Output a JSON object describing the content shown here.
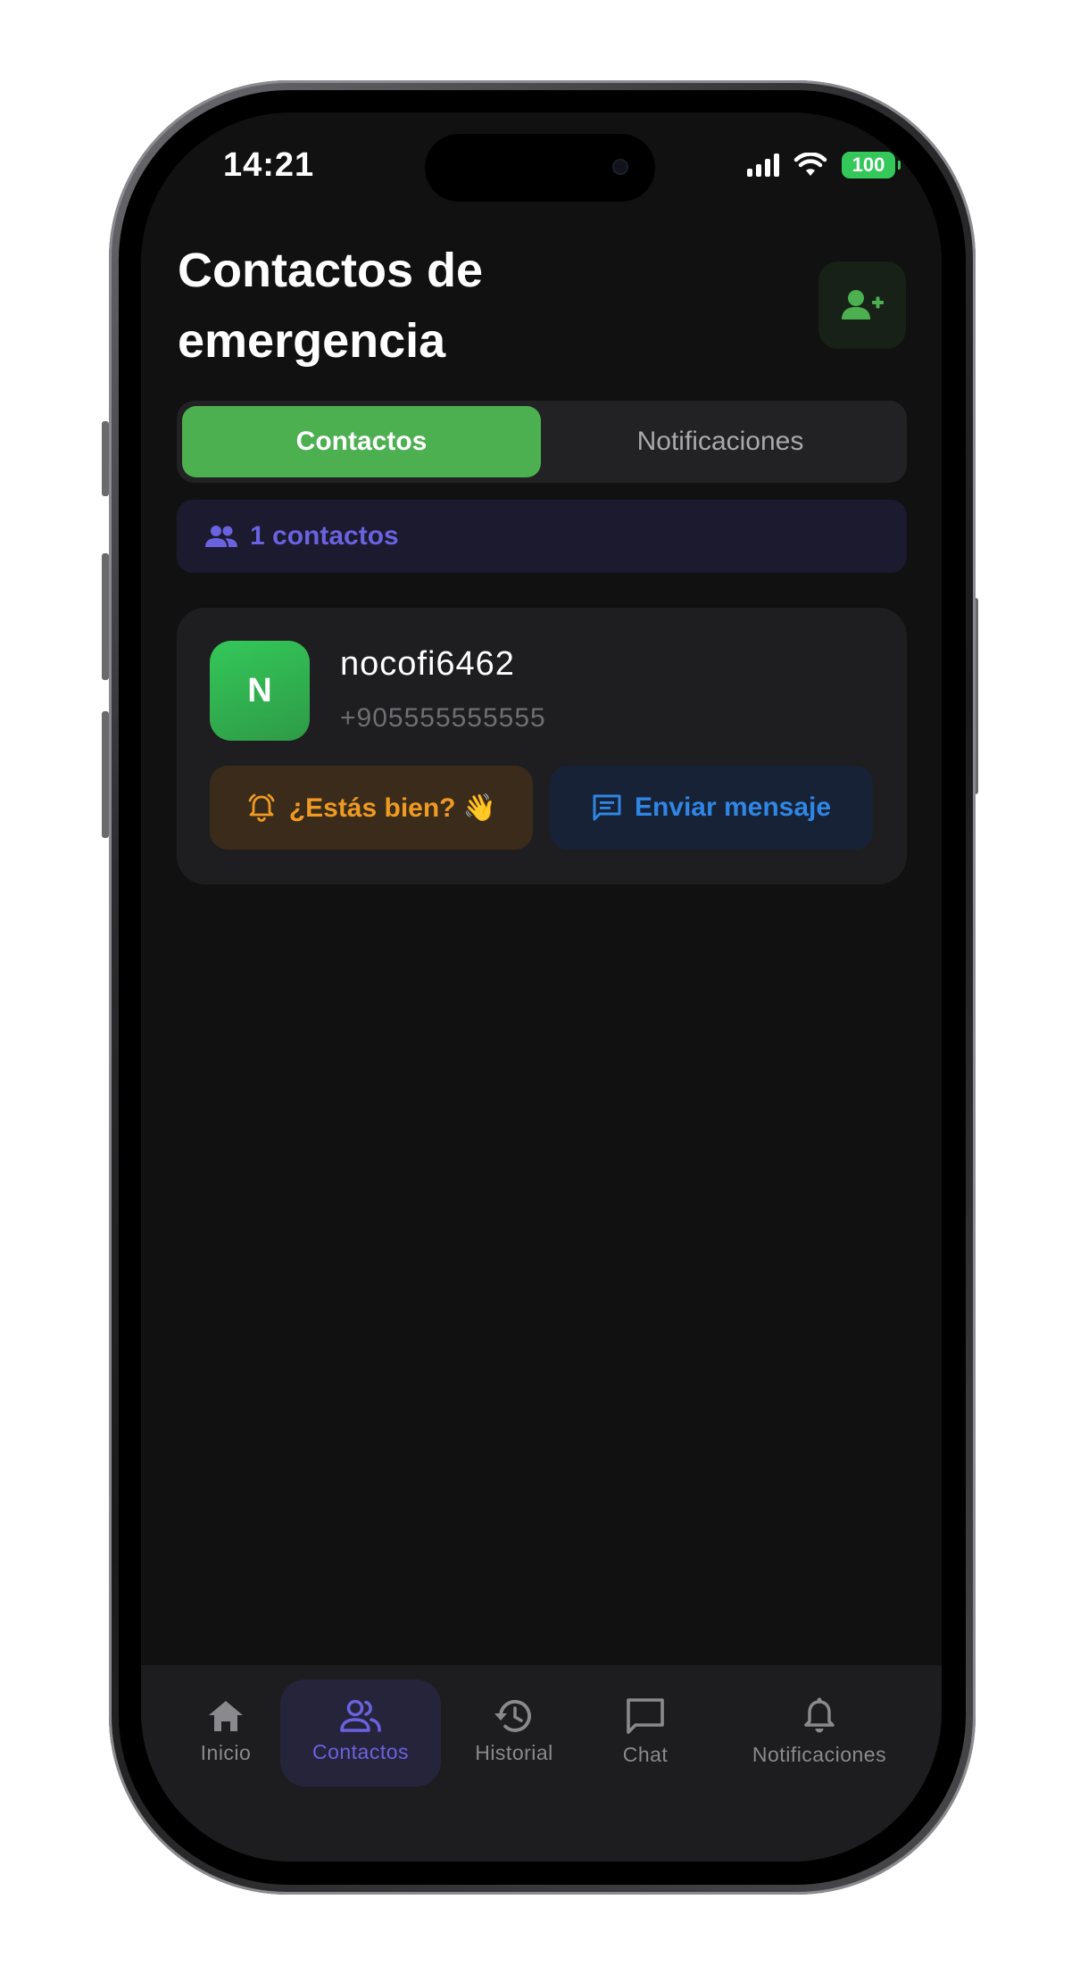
{
  "status_bar": {
    "time": "14:21",
    "battery": "100"
  },
  "header": {
    "title": "Contactos de emergencia"
  },
  "tabs": [
    {
      "label": "Contactos",
      "active": true
    },
    {
      "label": "Notificaciones",
      "active": false
    }
  ],
  "count_banner": {
    "text": "1 contactos"
  },
  "contacts": [
    {
      "initial": "N",
      "name": "nocofi6462",
      "phone": "+905555555555",
      "checkin_label": "¿Estás bien? 👋",
      "message_label": "Enviar mensaje"
    }
  ],
  "bottom_nav": [
    {
      "label": "Inicio",
      "icon": "home-icon"
    },
    {
      "label": "Contactos",
      "icon": "contacts-icon",
      "active": true
    },
    {
      "label": "Historial",
      "icon": "history-icon"
    },
    {
      "label": "Chat",
      "icon": "chat-icon"
    },
    {
      "label": "Notificaciones",
      "icon": "bell-icon"
    }
  ],
  "colors": {
    "accent_green": "#4caf50",
    "accent_purple": "#6b62e0",
    "checkin_orange": "#ef9a22",
    "message_blue": "#2f86e4",
    "background": "#111111"
  }
}
